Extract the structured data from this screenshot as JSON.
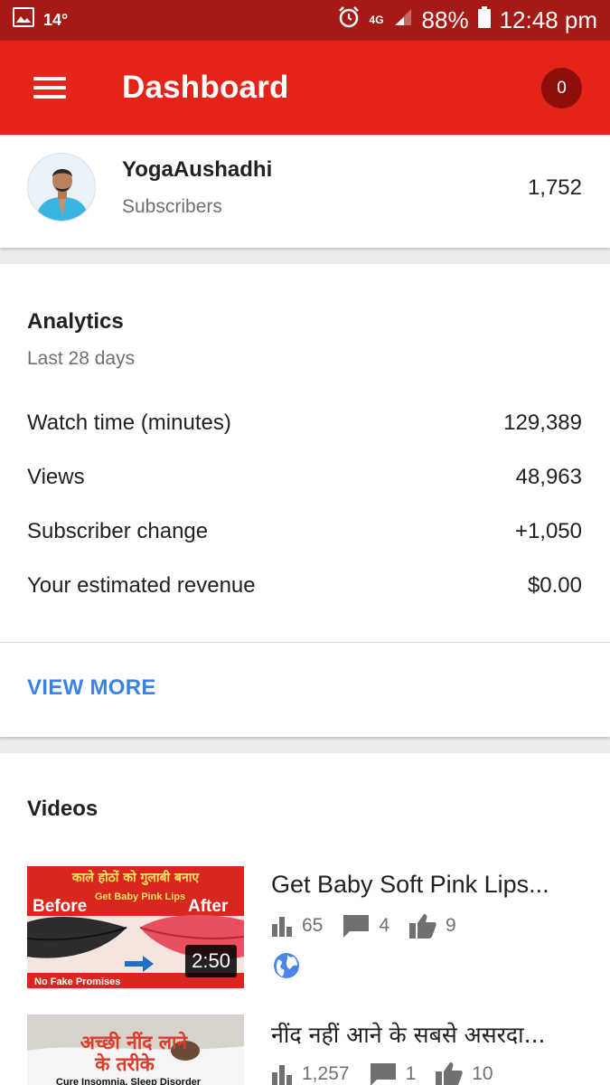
{
  "status_bar": {
    "temperature": "14°",
    "network": "4G",
    "battery": "88%",
    "time": "12:48 pm"
  },
  "app_bar": {
    "title": "Dashboard",
    "notification_count": "0"
  },
  "channel": {
    "name": "YogaAushadhi",
    "subscribers_label": "Subscribers",
    "subscribers_count": "1,752"
  },
  "analytics": {
    "title": "Analytics",
    "period": "Last 28 days",
    "rows": [
      {
        "label": "Watch time (minutes)",
        "value": "129,389"
      },
      {
        "label": "Views",
        "value": "48,963"
      },
      {
        "label": "Subscriber change",
        "value": "+1,050"
      },
      {
        "label": "Your estimated revenue",
        "value": "$0.00"
      }
    ],
    "view_more": "VIEW MORE"
  },
  "videos": {
    "title": "Videos",
    "items": [
      {
        "title": "Get Baby Soft Pink Lips...",
        "views": "65",
        "comments": "4",
        "likes": "9",
        "duration": "2:50",
        "thumb_text_top": "काले होठों को गुलाबी बनाए",
        "thumb_text_sub": "Get Baby Pink Lips",
        "thumb_before": "Before",
        "thumb_after": "After",
        "thumb_footer": "No Fake Promises",
        "visibility_icon": "globe-icon"
      },
      {
        "title": "नींद नहीं आने के सबसे असरदा...",
        "views": "1,257",
        "comments": "1",
        "likes": "10",
        "thumb_text_top": "अच्छी नींद लाने",
        "thumb_text_mid": "के तरीके",
        "thumb_footer": "Cure Insomnia, Sleep Disorder"
      }
    ]
  },
  "colors": {
    "status_bar": "#a51a17",
    "app_bar": "#e52419",
    "badge": "#8e0f0a",
    "link": "#3b82e6",
    "stat_icon": "#707070",
    "globe": "#4a86e8"
  }
}
